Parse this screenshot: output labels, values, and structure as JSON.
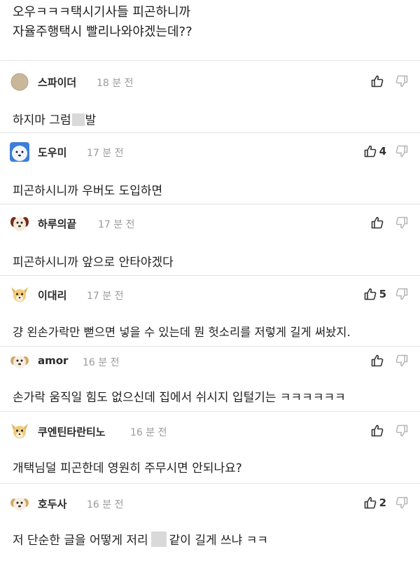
{
  "post": {
    "text_line1": "오우ㅋㅋㅋ택시기사들 피곤하니까",
    "text_line2": "자율주행택시 빨리나와야겠는데??"
  },
  "comments": [
    {
      "nickname": "스파이더",
      "time": "18 분 전",
      "avatar": "beige-circle-avatar",
      "likes": "",
      "body_before": "하지마 그럼",
      "body_after": "발",
      "censored": true
    },
    {
      "nickname": "도우미",
      "time": "17 분 전",
      "avatar": "white-dog-avatar",
      "likes": "4",
      "body": "피곤하시니까 우버도 도입하면"
    },
    {
      "nickname": "하루의끝",
      "time": "17 분 전",
      "avatar": "puppy-avatar",
      "likes": "",
      "body": "피곤하시니까 앞으로 안타야겠다"
    },
    {
      "nickname": "이대리",
      "time": "17 분 전",
      "avatar": "chihuahua-avatar",
      "likes": "5",
      "body": "걍 왼손가락만 뻗으면 넣을 수 있는데 뭔 헛소리를 저렇게 길게 써놨지."
    },
    {
      "nickname": "amor",
      "time": "16 분 전",
      "avatar": "puppy-avatar",
      "likes": "",
      "body": "손가락 움직일 힘도 없으신데 집에서 쉬시지 입털기는 ㅋㅋㅋㅋㅋㅋ"
    },
    {
      "nickname": "쿠엔틴타란티노",
      "time": "16 분 전",
      "avatar": "chihuahua-avatar",
      "likes": "",
      "body": "개택님덜 피곤한데 영원히 주무시면 안되나요?"
    },
    {
      "nickname": "호두사",
      "time": "16 분 전",
      "avatar": "puppy-avatar",
      "likes": "2",
      "body_before": "저 단순한 글을 어떻게 저리",
      "body_after": "같이 길게 쓰냐 ㅋㅋ",
      "censored": true
    }
  ],
  "colors": {
    "text": "#1f1f1f",
    "time": "#9a9a9a",
    "divider": "#e4e4e4",
    "censor": "#d9d9d9"
  },
  "icons": {
    "like": "thumbs-up-icon",
    "dislike": "thumbs-down-icon"
  }
}
